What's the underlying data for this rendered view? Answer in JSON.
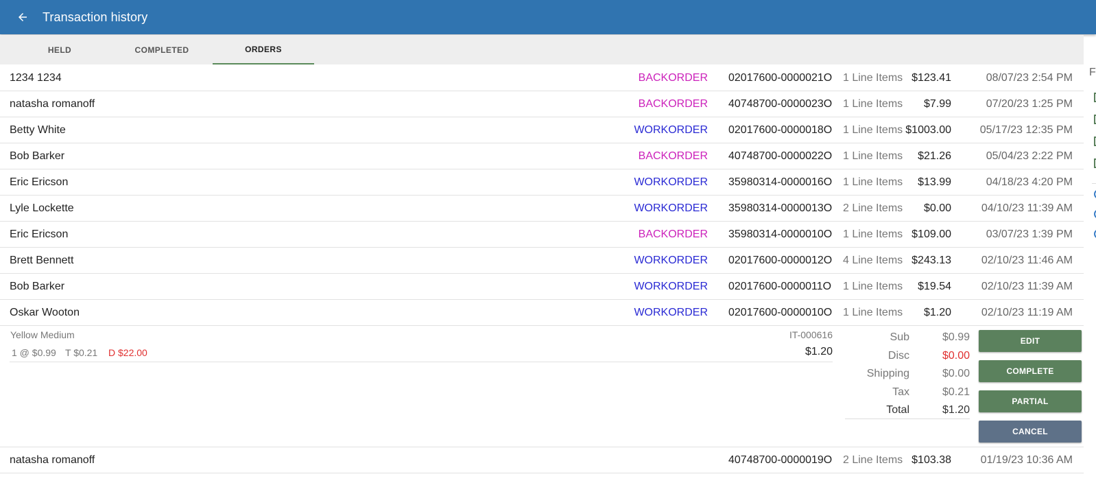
{
  "app": {
    "title": "Transaction history"
  },
  "tabs": [
    {
      "label": "HELD"
    },
    {
      "label": "COMPLETED"
    },
    {
      "label": "ORDERS"
    }
  ],
  "orders": [
    {
      "name": "1234 1234",
      "type": "BACKORDER",
      "id": "02017600-0000021O",
      "lines": "1 Line Items",
      "amount": "$123.41",
      "date": "08/07/23 2:54 PM"
    },
    {
      "name": "natasha romanoff",
      "type": "BACKORDER",
      "id": "40748700-0000023O",
      "lines": "1 Line Items",
      "amount": "$7.99",
      "date": "07/20/23 1:25 PM"
    },
    {
      "name": "Betty  White",
      "type": "WORKORDER",
      "id": "02017600-0000018O",
      "lines": "1 Line Items",
      "amount": "$1003.00",
      "date": "05/17/23 12:35 PM"
    },
    {
      "name": "Bob Barker",
      "type": "BACKORDER",
      "id": "40748700-0000022O",
      "lines": "1 Line Items",
      "amount": "$21.26",
      "date": "05/04/23 2:22 PM"
    },
    {
      "name": "Eric  Ericson",
      "type": "WORKORDER",
      "id": "35980314-0000016O",
      "lines": "1 Line Items",
      "amount": "$13.99",
      "date": "04/18/23 4:20 PM"
    },
    {
      "name": "Lyle  Lockette",
      "type": "WORKORDER",
      "id": "35980314-0000013O",
      "lines": "2 Line Items",
      "amount": "$0.00",
      "date": "04/10/23 11:39 AM"
    },
    {
      "name": "Eric  Ericson",
      "type": "BACKORDER",
      "id": "35980314-0000010O",
      "lines": "1 Line Items",
      "amount": "$109.00",
      "date": "03/07/23 1:39 PM"
    },
    {
      "name": "Brett Bennett",
      "type": "WORKORDER",
      "id": "02017600-0000012O",
      "lines": "4 Line Items",
      "amount": "$243.13",
      "date": "02/10/23 11:46 AM"
    },
    {
      "name": "Bob Barker",
      "type": "WORKORDER",
      "id": "02017600-0000011O",
      "lines": "1 Line Items",
      "amount": "$19.54",
      "date": "02/10/23 11:39 AM"
    },
    {
      "name": "Oskar Wooton",
      "type": "WORKORDER",
      "id": "02017600-0000010O",
      "lines": "1 Line Items",
      "amount": "$1.20",
      "date": "02/10/23 11:19 AM"
    }
  ],
  "detail": {
    "item_name": "Yellow Medium",
    "item_code": "IT-000616",
    "qty_price": "1 @ $0.99",
    "tax": "T $0.21",
    "discount": "D $22.00",
    "line_total": "$1.20",
    "totals": [
      {
        "label": "Sub",
        "value": "$0.99"
      },
      {
        "label": "Disc",
        "value": "$0.00"
      },
      {
        "label": "Shipping",
        "value": "$0.00"
      },
      {
        "label": "Tax",
        "value": "$0.21"
      },
      {
        "label": "Total",
        "value": "$1.20"
      }
    ],
    "buttons": {
      "edit": "EDIT",
      "complete": "COMPLETE",
      "partial": "PARTIAL",
      "cancel": "CANCEL"
    }
  },
  "last_order": {
    "name": "natasha romanoff",
    "type": "",
    "id": "40748700-0000019O",
    "lines": "2 Line Items",
    "amount": "$103.38",
    "date": "01/19/23 10:36 AM"
  },
  "side_panel": {
    "letter": "F"
  },
  "colors": {
    "appbar": "#3074b0",
    "backorder": "#cc22bb",
    "workorder": "#2a2ad4",
    "button_green": "#5b815d",
    "button_slate": "#5e7188",
    "discount_red": "#e03030"
  },
  "icons": {
    "back": "arrow-left-icon"
  }
}
